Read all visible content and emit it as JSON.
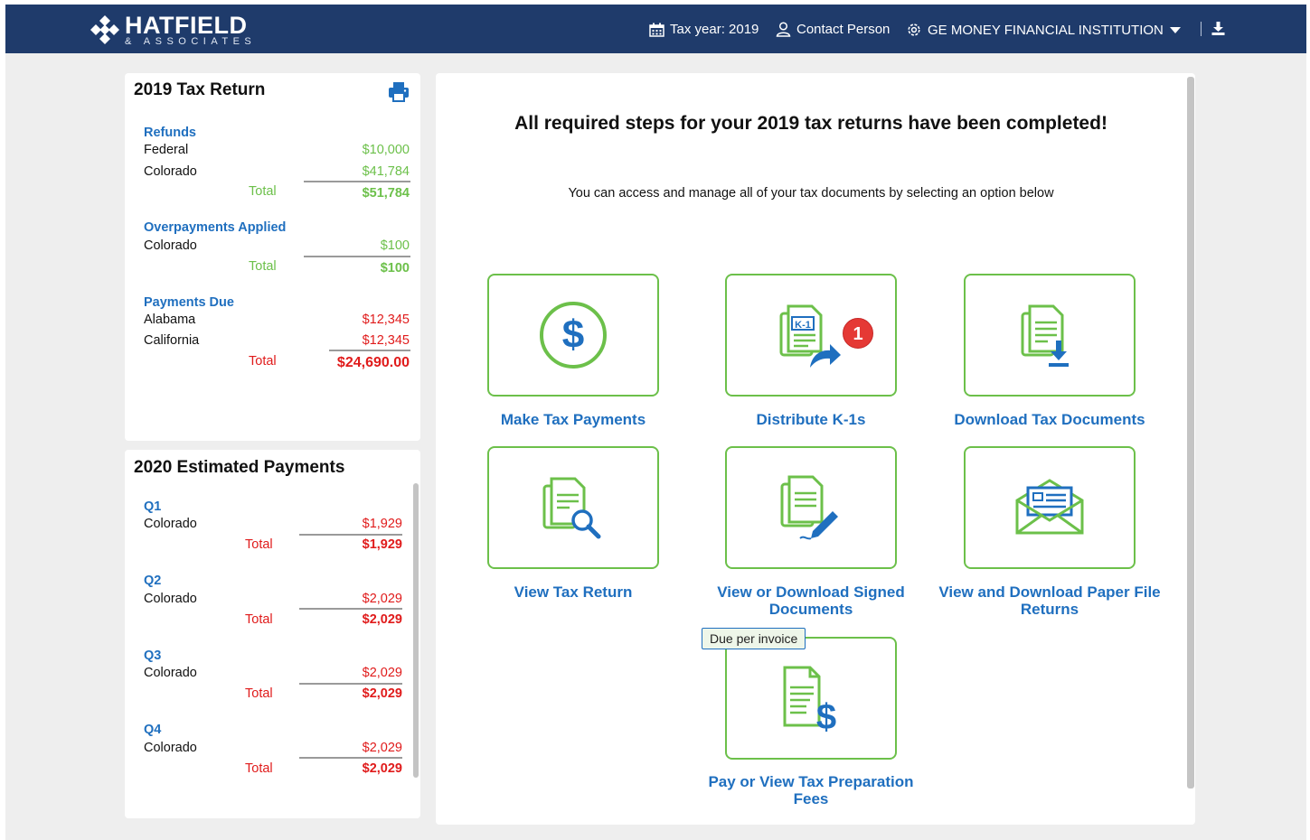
{
  "header": {
    "brand_name": "HATFIELD",
    "brand_sub": "& ASSOCIATES",
    "tax_year": "Tax year: 2019",
    "contact": "Contact Person",
    "firm": "GE MONEY FINANCIAL INSTITUTION"
  },
  "tax_return": {
    "title": "2019 Tax Return",
    "refunds": {
      "heading": "Refunds",
      "rows": [
        {
          "label": "Federal",
          "amount": "$10,000"
        },
        {
          "label": "Colorado",
          "amount": "$41,784"
        }
      ],
      "total_label": "Total",
      "total": "$51,784"
    },
    "overpayments": {
      "heading": "Overpayments Applied",
      "rows": [
        {
          "label": "Colorado",
          "amount": "$100"
        }
      ],
      "total_label": "Total",
      "total": "$100"
    },
    "payments_due": {
      "heading": "Payments Due",
      "rows": [
        {
          "label": "Alabama",
          "amount": "$12,345"
        },
        {
          "label": "California",
          "amount": "$12,345"
        }
      ],
      "total_label": "Total",
      "total": "$24,690.00"
    }
  },
  "estimated": {
    "title": "2020 Estimated Payments",
    "quarters": [
      {
        "heading": "Q1",
        "label": "Colorado",
        "amount": "$1,929",
        "total_label": "Total",
        "total": "$1,929"
      },
      {
        "heading": "Q2",
        "label": "Colorado",
        "amount": "$2,029",
        "total_label": "Total",
        "total": "$2,029"
      },
      {
        "heading": "Q3",
        "label": "Colorado",
        "amount": "$2,029",
        "total_label": "Total",
        "total": "$2,029"
      },
      {
        "heading": "Q4",
        "label": "Colorado",
        "amount": "$2,029",
        "total_label": "Total",
        "total": "$2,029"
      }
    ]
  },
  "main": {
    "headline": "All required steps for your 2019 tax returns have been completed!",
    "subline": "You can access and manage all of your tax documents by selecting an option below",
    "tiles": [
      {
        "label": "Make Tax Payments",
        "icon": "dollar-circle-icon"
      },
      {
        "label": "Distribute K-1s",
        "icon": "k1-share-icon",
        "badge": "1"
      },
      {
        "label": "Download Tax Documents",
        "icon": "document-download-icon"
      },
      {
        "label": "View Tax Return",
        "icon": "document-search-icon"
      },
      {
        "label": "View or Download Signed Documents",
        "icon": "document-sign-icon"
      },
      {
        "label": "View and Download Paper File Returns",
        "icon": "envelope-document-icon"
      },
      {
        "label": "Pay or View Tax Preparation Fees",
        "icon": "document-dollar-icon",
        "tooltip": "Due per invoice"
      }
    ]
  },
  "colors": {
    "header_bg": "#1f3b6b",
    "accent_blue": "#1f6fbf",
    "tile_border_green": "#6cc04a",
    "refund_green": "#6cc04a",
    "due_red": "#e01b1b",
    "badge_red": "#e53935"
  }
}
